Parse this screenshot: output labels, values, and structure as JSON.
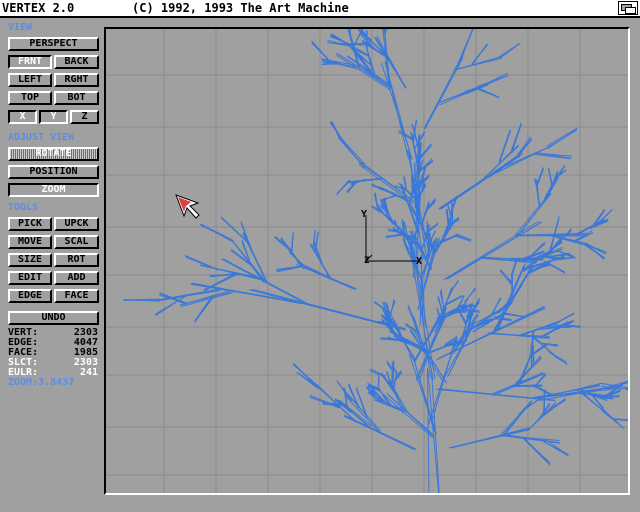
{
  "titlebar": {
    "app": "VERTEX 2.0",
    "credit": "(C) 1992, 1993 The Art Machine"
  },
  "view": {
    "label": "VIEW",
    "perspect": "PERSPECT",
    "frnt": "FRNT",
    "back": "BACK",
    "left": "LEFT",
    "rght": "RGHT",
    "top": "TOP",
    "bot": "BOT",
    "x": "X",
    "y": "Y",
    "z": "Z"
  },
  "adjust": {
    "label": "ADJUST VIEW",
    "rotate": "ROTATE",
    "position": "POSITION",
    "zoom": "ZOOM"
  },
  "tools": {
    "label": "TOOLS",
    "pick": "PICK",
    "upck": "UPCK",
    "move": "MOVE",
    "scal": "SCAL",
    "size": "SIZE",
    "rot": "ROT",
    "edit": "EDIT",
    "add": "ADD",
    "edge": "EDGE",
    "face": "FACE",
    "undo": "UNDO"
  },
  "stats": {
    "vert_label": "VERT:",
    "vert": "2303",
    "edge_label": "EDGE:",
    "edge": "4047",
    "face_label": "FACE:",
    "face": "1985",
    "slct_label": "SLCT:",
    "slct": "2303",
    "eulr_label": "EULR:",
    "eulr": "241",
    "zoom_label": "ZOOM:3.8437"
  },
  "axes": {
    "x": "X",
    "y": "Y",
    "z": "Z"
  },
  "colors": {
    "wire": "#3a78d8",
    "accent": "#5a8ee6",
    "face": "#a0a0a0"
  }
}
